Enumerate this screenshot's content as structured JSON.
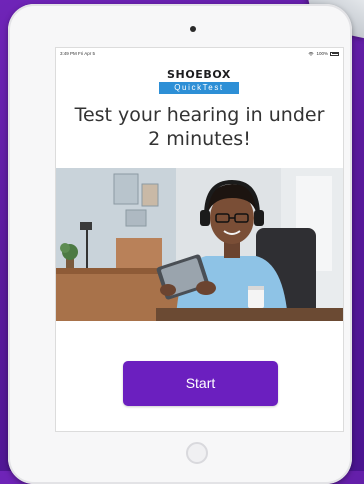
{
  "status_bar": {
    "time_date": "3:49 PM  Fri Apr 5",
    "battery": "100%"
  },
  "logo": {
    "top": "SHOEBOX",
    "bottom": "QuickTest"
  },
  "headline": "Test your hearing in under 2 minutes!",
  "start_label": "Start",
  "colors": {
    "accent": "#6b1fbf",
    "background": "#5a1a9c",
    "logo_blue": "#2d8fd6"
  },
  "icons": [
    "wifi-icon",
    "battery-icon",
    "camera-icon",
    "home-button"
  ]
}
